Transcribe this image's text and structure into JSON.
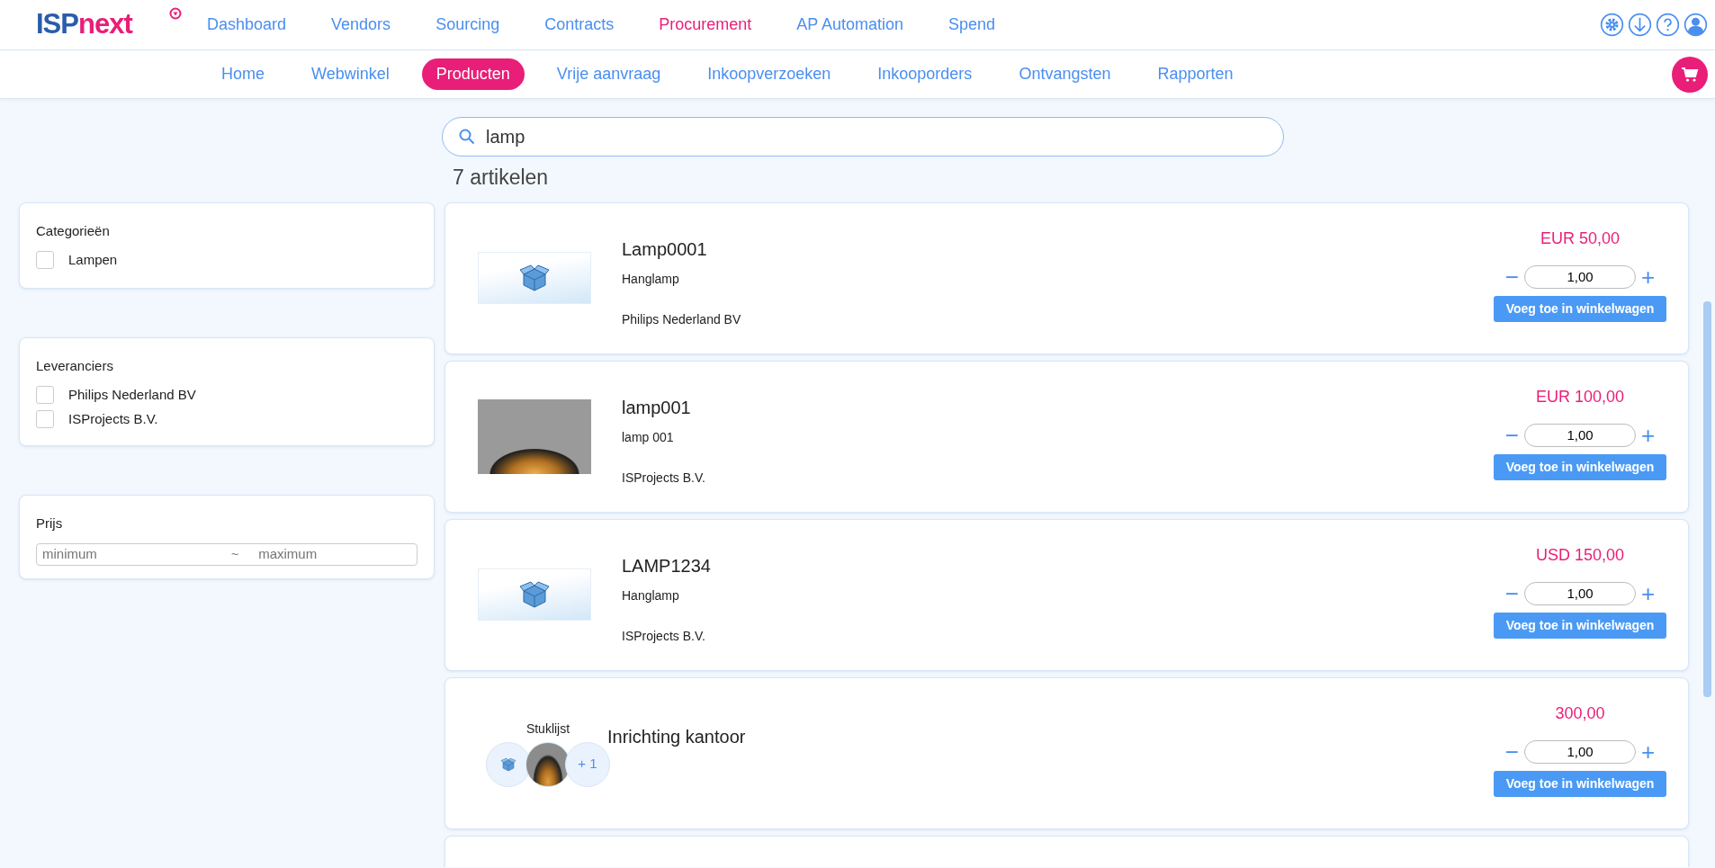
{
  "logo": {
    "part1": "ISP",
    "part2": "next"
  },
  "main_nav": [
    {
      "label": "Dashboard",
      "selected": false
    },
    {
      "label": "Vendors",
      "selected": false
    },
    {
      "label": "Sourcing",
      "selected": false
    },
    {
      "label": "Contracts",
      "selected": false
    },
    {
      "label": "Procurement",
      "selected": true
    },
    {
      "label": "AP Automation",
      "selected": false
    },
    {
      "label": "Spend",
      "selected": false
    }
  ],
  "sub_nav": [
    {
      "label": "Home",
      "selected": false
    },
    {
      "label": "Webwinkel",
      "selected": false
    },
    {
      "label": "Producten",
      "selected": true
    },
    {
      "label": "Vrije aanvraag",
      "selected": false
    },
    {
      "label": "Inkoopverzoeken",
      "selected": false
    },
    {
      "label": "Inkooporders",
      "selected": false
    },
    {
      "label": "Ontvangsten",
      "selected": false
    },
    {
      "label": "Rapporten",
      "selected": false
    }
  ],
  "search": {
    "value": "lamp"
  },
  "result_count": "7 artikelen",
  "filters": [
    {
      "kind": "checklist",
      "title": "Categorieën",
      "options": [
        {
          "label": "Lampen",
          "checked": false
        }
      ]
    },
    {
      "kind": "checklist",
      "title": "Leveranciers",
      "options": [
        {
          "label": "Philips Nederland BV",
          "checked": false
        },
        {
          "label": "ISProjects B.V.",
          "checked": false
        }
      ]
    },
    {
      "kind": "range",
      "title": "Prijs",
      "min_placeholder": "minimum",
      "separator": "~",
      "max_placeholder": "maximum"
    }
  ],
  "products": [
    {
      "kind": "placeholder",
      "name": "Lamp0001",
      "description": "Hanglamp",
      "supplier": "Philips Nederland BV",
      "price": "EUR 50,00",
      "quantity": "1,00",
      "minus": "−",
      "plus": "+",
      "button": "Voeg toe in winkelwagen"
    },
    {
      "kind": "photo",
      "name": "lamp001",
      "description": "lamp 001",
      "supplier": "ISProjects B.V.",
      "price": "EUR 100,00",
      "quantity": "1,00",
      "minus": "−",
      "plus": "+",
      "button": "Voeg toe in winkelwagen"
    },
    {
      "kind": "placeholder",
      "name": "LAMP1234",
      "description": "Hanglamp",
      "supplier": "ISProjects B.V.",
      "price": "USD 150,00",
      "quantity": "1,00",
      "minus": "−",
      "plus": "+",
      "button": "Voeg toe in winkelwagen"
    },
    {
      "kind": "bundle",
      "bundle_label": "Stuklijst",
      "bundle_extra": "+ 1",
      "name": "Inrichting kantoor",
      "price": "300,00",
      "quantity": "1,00",
      "minus": "−",
      "plus": "+",
      "button": "Voeg toe in winkelwagen"
    },
    {
      "kind": "empty"
    }
  ]
}
